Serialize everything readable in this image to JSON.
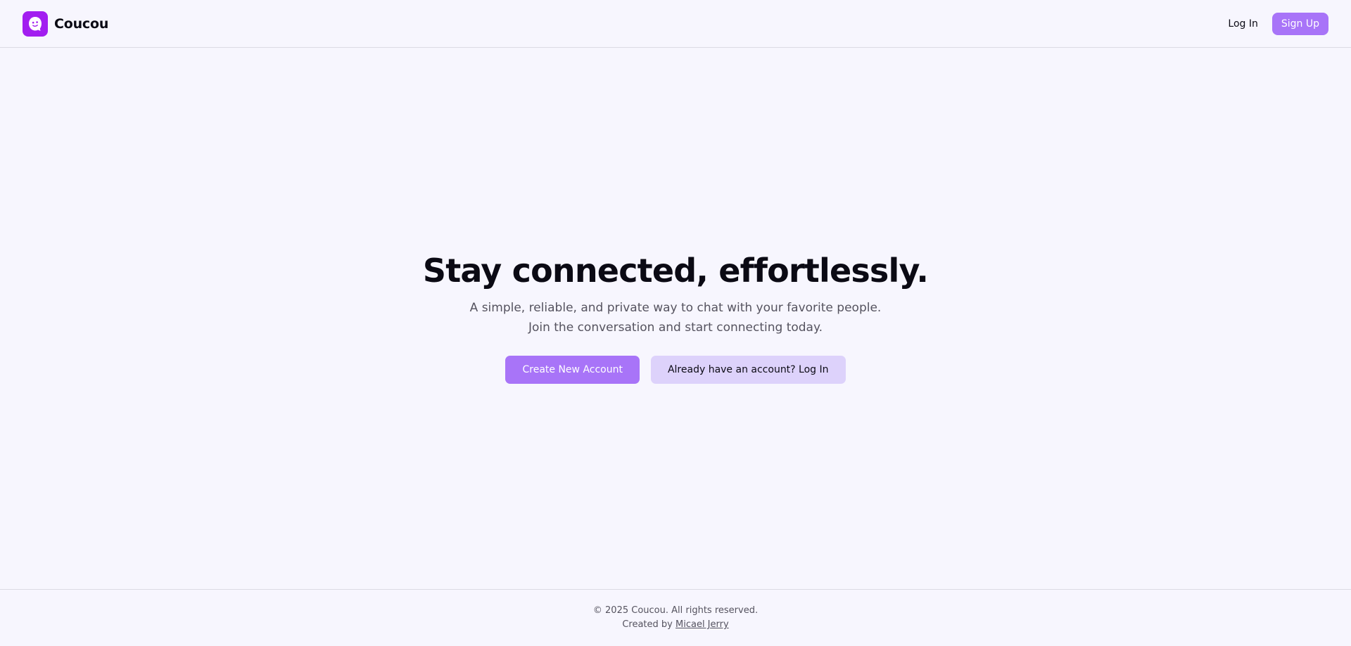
{
  "header": {
    "brand_name": "Coucou",
    "logo_icon": "smiley-ghost-icon",
    "login_label": "Log In",
    "signup_label": "Sign Up"
  },
  "hero": {
    "title": "Stay connected, effortlessly.",
    "subtitle_line1": "A simple, reliable, and private way to chat with your favorite people.",
    "subtitle_line2": "Join the conversation and start connecting today.",
    "primary_cta": "Create New Account",
    "secondary_cta": "Already have an account? Log In"
  },
  "footer": {
    "copyright": "© 2025 Coucou. All rights reserved.",
    "created_by_prefix": "Created by",
    "author": "Micael Jerry"
  },
  "colors": {
    "brand": "#a21ef0",
    "accent": "#a874f8",
    "secondary": "#ddd2fb",
    "background": "#f7f6fe"
  }
}
